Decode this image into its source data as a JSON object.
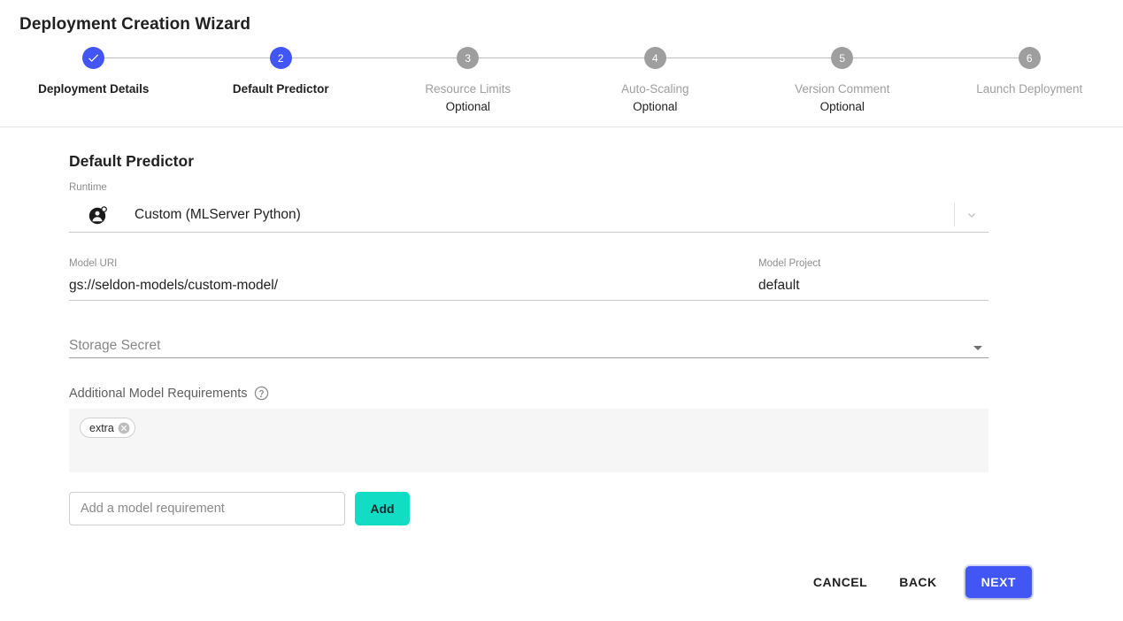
{
  "header": {
    "title": "Deployment Creation Wizard"
  },
  "stepper": {
    "steps": [
      {
        "number": "",
        "label": "Deployment Details",
        "optional": "",
        "state": "done",
        "icon": "check-icon"
      },
      {
        "number": "2",
        "label": "Default Predictor",
        "optional": "",
        "state": "active",
        "icon": ""
      },
      {
        "number": "3",
        "label": "Resource Limits",
        "optional": "Optional",
        "state": "todo",
        "icon": ""
      },
      {
        "number": "4",
        "label": "Auto-Scaling",
        "optional": "Optional",
        "state": "todo",
        "icon": ""
      },
      {
        "number": "5",
        "label": "Version Comment",
        "optional": "Optional",
        "state": "todo",
        "icon": ""
      },
      {
        "number": "6",
        "label": "Launch Deployment",
        "optional": "",
        "state": "todo",
        "icon": ""
      }
    ]
  },
  "form": {
    "section_title": "Default Predictor",
    "runtime": {
      "label": "Runtime",
      "value": "Custom (MLServer Python)",
      "icon": "custom-runtime-icon",
      "chevron": "chevron-down-icon"
    },
    "model_uri": {
      "label": "Model URI",
      "value": "gs://seldon-models/custom-model/"
    },
    "model_project": {
      "label": "Model Project",
      "value": "default"
    },
    "storage_secret": {
      "placeholder": "Storage Secret",
      "value": "",
      "arrow": "triangle-down-icon"
    },
    "additional_requirements": {
      "label": "Additional Model Requirements",
      "help_icon": "help-circle-icon",
      "chips": [
        {
          "text": "extra",
          "remove_icon": "chip-remove-icon"
        }
      ],
      "input_placeholder": "Add a model requirement",
      "input_value": "",
      "add_label": "Add"
    }
  },
  "footer": {
    "cancel_label": "CANCEL",
    "back_label": "BACK",
    "next_label": "NEXT"
  },
  "colors": {
    "primary_blue": "#4255f5",
    "step_inactive_gray": "#9e9e9e",
    "add_teal": "#12dcc4",
    "chips_bg": "#f6f6f6"
  }
}
